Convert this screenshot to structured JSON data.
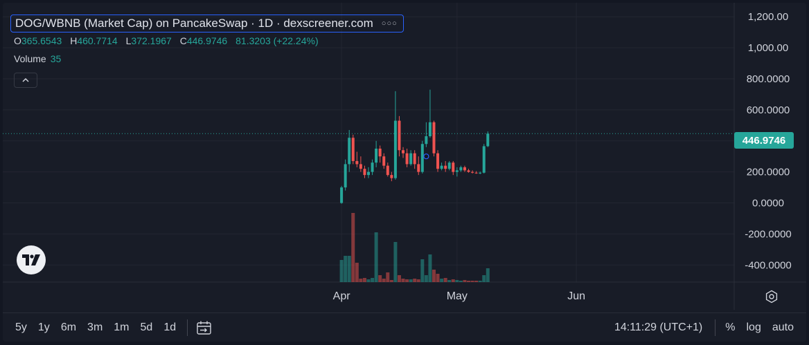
{
  "legend": {
    "title": "DOG/WBNB (Market Cap) on PancakeSwap · 1D · dexscreener.com",
    "ohlc": [
      {
        "key": "O",
        "value": "365.6543"
      },
      {
        "key": "H",
        "value": "460.7714"
      },
      {
        "key": "L",
        "value": "372.1967"
      },
      {
        "key": "C",
        "value": "446.9746"
      }
    ],
    "change": "81.3203 (+22.24%)",
    "volume_label": "Volume",
    "volume_value": "35"
  },
  "last_price": "446.9746",
  "bottom_bar": {
    "ranges": [
      "5y",
      "1y",
      "6m",
      "3m",
      "1m",
      "5d",
      "1d"
    ],
    "time": "14:11:29 (UTC+1)",
    "percent": "%",
    "log": "log",
    "auto": "auto"
  },
  "colors": {
    "up": "#26a69a",
    "down": "#ef5350",
    "background": "#181c27",
    "grid": "#232632"
  },
  "chart_data": {
    "type": "candlestick",
    "title": "DOG/WBNB (Market Cap) on PancakeSwap · 1D · dexscreener.com",
    "y_ticks": [
      1200,
      1000,
      800,
      600,
      400,
      200,
      0,
      -200,
      -400
    ],
    "y_tick_labels": [
      "1,200.00",
      "1,000.00",
      "800.0000",
      "600.0000",
      "",
      "200.0000",
      "0.0000",
      "-200.0000",
      "-400.0000"
    ],
    "ylim": [
      -510,
      1290
    ],
    "x_tick_labels": [
      {
        "label": "Apr",
        "index": 0
      },
      {
        "label": "May",
        "index": 30
      },
      {
        "label": "Jun",
        "index": 61
      }
    ],
    "x_range": [
      -88,
      102
    ],
    "grid": true,
    "current_price": 446.9746,
    "candles": [
      {
        "o": 0,
        "h": 110,
        "l": -5,
        "c": 100,
        "v": 0.32
      },
      {
        "o": 100,
        "h": 280,
        "l": 80,
        "c": 250,
        "v": 0.38
      },
      {
        "o": 250,
        "h": 470,
        "l": 200,
        "c": 420,
        "v": 0.38
      },
      {
        "o": 420,
        "h": 440,
        "l": 250,
        "c": 270,
        "v": 1.0
      },
      {
        "o": 270,
        "h": 330,
        "l": 230,
        "c": 250,
        "v": 0.28
      },
      {
        "o": 250,
        "h": 300,
        "l": 200,
        "c": 220,
        "v": 0.05
      },
      {
        "o": 220,
        "h": 240,
        "l": 160,
        "c": 180,
        "v": 0.06
      },
      {
        "o": 180,
        "h": 230,
        "l": 160,
        "c": 200,
        "v": 0.04
      },
      {
        "o": 200,
        "h": 280,
        "l": 180,
        "c": 260,
        "v": 0.06
      },
      {
        "o": 260,
        "h": 400,
        "l": 230,
        "c": 350,
        "v": 0.72
      },
      {
        "o": 350,
        "h": 370,
        "l": 260,
        "c": 300,
        "v": 0.1
      },
      {
        "o": 300,
        "h": 320,
        "l": 220,
        "c": 240,
        "v": 0.05
      },
      {
        "o": 240,
        "h": 260,
        "l": 170,
        "c": 180,
        "v": 0.14
      },
      {
        "o": 180,
        "h": 200,
        "l": 140,
        "c": 160,
        "v": 0.03
      },
      {
        "o": 160,
        "h": 720,
        "l": 150,
        "c": 530,
        "v": 0.58
      },
      {
        "o": 530,
        "h": 560,
        "l": 300,
        "c": 340,
        "v": 0.1
      },
      {
        "o": 340,
        "h": 360,
        "l": 290,
        "c": 320,
        "v": 0.05
      },
      {
        "o": 320,
        "h": 350,
        "l": 230,
        "c": 250,
        "v": 0.04
      },
      {
        "o": 250,
        "h": 340,
        "l": 240,
        "c": 320,
        "v": 0.04
      },
      {
        "o": 320,
        "h": 340,
        "l": 220,
        "c": 250,
        "v": 0.05
      },
      {
        "o": 250,
        "h": 300,
        "l": 180,
        "c": 200,
        "v": 0.04
      },
      {
        "o": 200,
        "h": 400,
        "l": 190,
        "c": 380,
        "v": 0.33
      },
      {
        "o": 380,
        "h": 520,
        "l": 360,
        "c": 430,
        "v": 0.1
      },
      {
        "o": 430,
        "h": 730,
        "l": 420,
        "c": 520,
        "v": 0.4
      },
      {
        "o": 520,
        "h": 530,
        "l": 300,
        "c": 320,
        "v": 0.18
      },
      {
        "o": 320,
        "h": 340,
        "l": 200,
        "c": 220,
        "v": 0.12
      },
      {
        "o": 220,
        "h": 260,
        "l": 210,
        "c": 240,
        "v": 0.05
      },
      {
        "o": 240,
        "h": 270,
        "l": 200,
        "c": 220,
        "v": 0.06
      },
      {
        "o": 220,
        "h": 270,
        "l": 210,
        "c": 260,
        "v": 0.03
      },
      {
        "o": 260,
        "h": 270,
        "l": 180,
        "c": 200,
        "v": 0.04
      },
      {
        "o": 200,
        "h": 230,
        "l": 170,
        "c": 210,
        "v": 0.03
      },
      {
        "o": 210,
        "h": 240,
        "l": 200,
        "c": 230,
        "v": 0.02
      },
      {
        "o": 230,
        "h": 240,
        "l": 200,
        "c": 210,
        "v": 0.03
      },
      {
        "o": 210,
        "h": 220,
        "l": 195,
        "c": 200,
        "v": 0.02
      },
      {
        "o": 200,
        "h": 210,
        "l": 190,
        "c": 195,
        "v": 0.02
      },
      {
        "o": 195,
        "h": 205,
        "l": 188,
        "c": 192,
        "v": 0.02
      },
      {
        "o": 192,
        "h": 202,
        "l": 185,
        "c": 195,
        "v": 0.02
      },
      {
        "o": 195,
        "h": 380,
        "l": 190,
        "c": 365.6543,
        "v": 0.1
      },
      {
        "o": 365.6543,
        "h": 460.7714,
        "l": 360,
        "c": 446.9746,
        "v": 0.2
      }
    ]
  }
}
